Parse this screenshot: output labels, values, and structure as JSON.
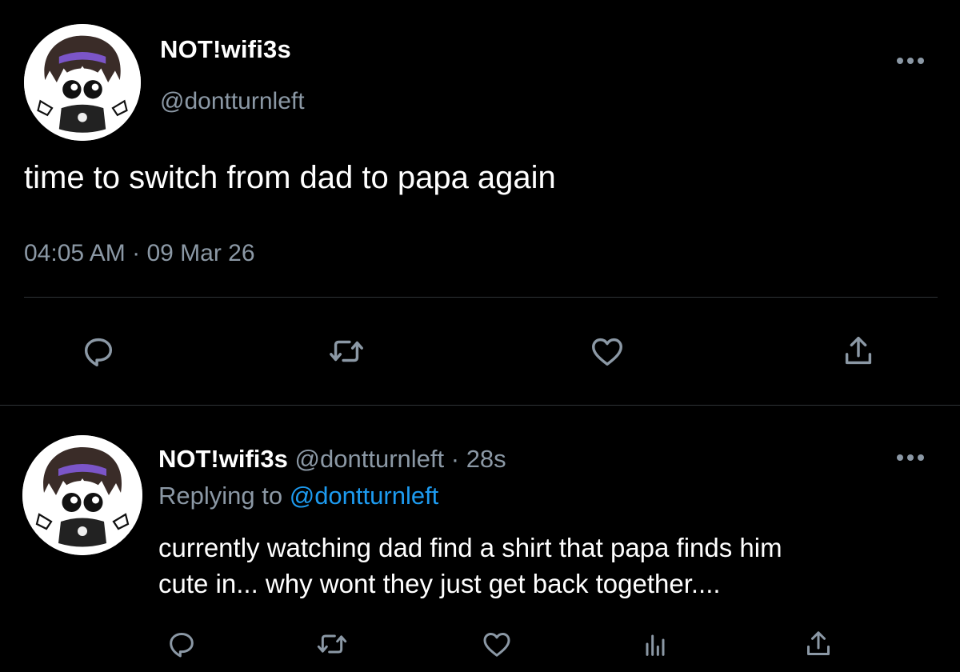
{
  "main_tweet": {
    "display_name": "NOT!wifi3s",
    "handle": "@dontturnleft",
    "text": "time to switch from dad to papa again",
    "time": "04:05 AM",
    "separator": "·",
    "date": "09 Mar 26",
    "actions": [
      "reply-icon",
      "retweet-icon",
      "like-icon",
      "share-icon"
    ]
  },
  "reply_tweet": {
    "display_name": "NOT!wifi3s",
    "handle": "@dontturnleft",
    "separator": "·",
    "time": "28s",
    "replying_prefix": "Replying to",
    "replying_to": "@dontturnleft",
    "text_line1": "currently watching dad find a shirt that papa finds him",
    "text_line2": "cute in... why wont they just get back together....",
    "actions": [
      "reply-icon",
      "retweet-icon",
      "like-icon",
      "analytics-icon",
      "share-icon"
    ]
  },
  "colors": {
    "background": "#000000",
    "text_primary": "#ffffff",
    "text_secondary": "#8b98a5",
    "link": "#1d9bf0",
    "divider": "#2f3336"
  }
}
